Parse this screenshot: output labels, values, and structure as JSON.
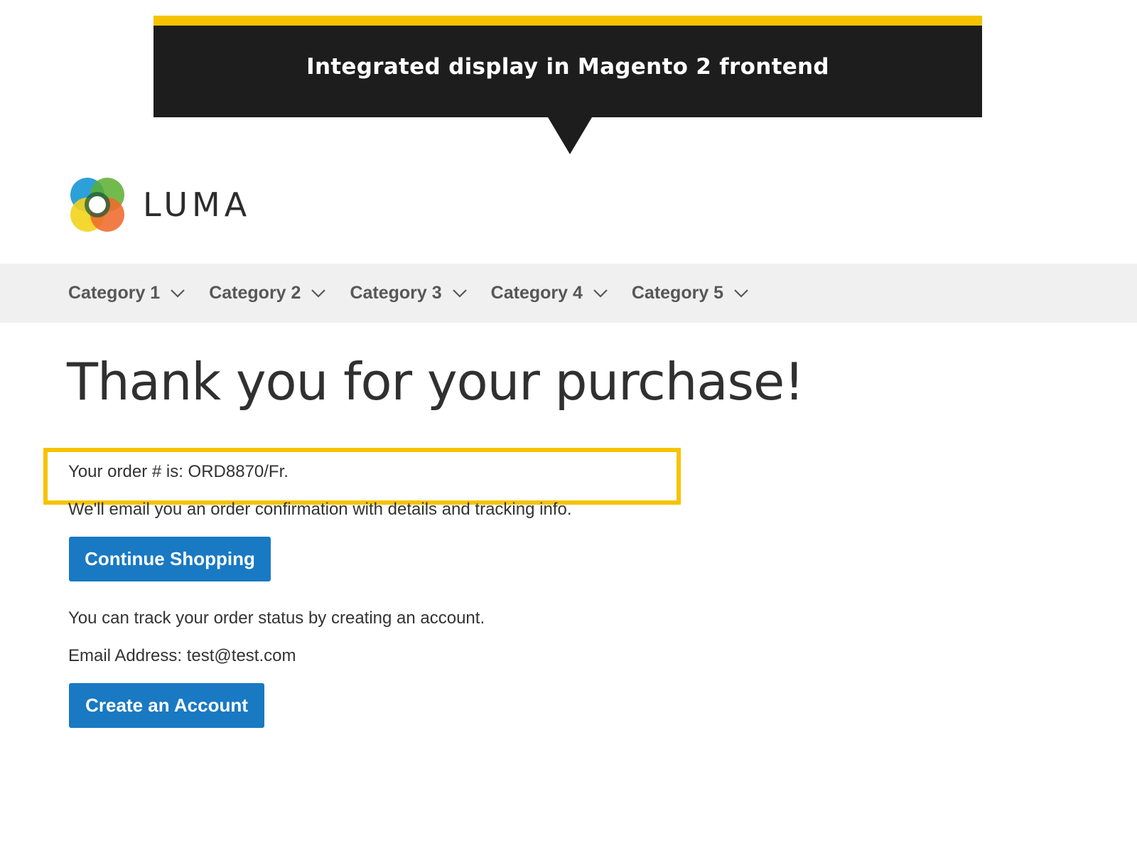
{
  "callout": {
    "title": "Integrated display in Magento 2 frontend",
    "background_color": "#1d1d1d",
    "accent_color": "#f6c300"
  },
  "header": {
    "logo_text": "LUMA",
    "logo_icon": "luma-logo-icon"
  },
  "nav": {
    "items": [
      {
        "label": "Category 1",
        "icon": "chevron-down-icon"
      },
      {
        "label": "Category 2",
        "icon": "chevron-down-icon"
      },
      {
        "label": "Category 3",
        "icon": "chevron-down-icon"
      },
      {
        "label": "Category 4",
        "icon": "chevron-down-icon"
      },
      {
        "label": "Category 5",
        "icon": "chevron-down-icon"
      }
    ]
  },
  "main": {
    "title": "Thank you for your purchase!",
    "order_line": "Your order # is: ORD8870/Fr.",
    "confirmation_line": "We'll email you an order confirmation with details and tracking info.",
    "continue_button": "Continue Shopping",
    "track_line": "You can track your order status by creating an account.",
    "email_line": "Email Address: test@test.com",
    "create_account_button": "Create an Account"
  },
  "colors": {
    "button": "#1979c3",
    "highlight": "#f6c300",
    "nav_background": "#f0f0f0"
  }
}
